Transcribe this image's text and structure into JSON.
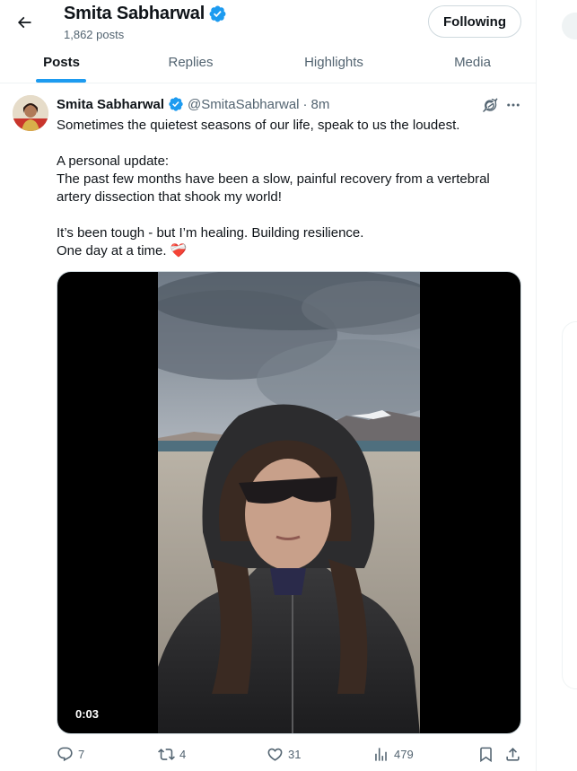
{
  "header": {
    "name": "Smita Sabharwal",
    "post_count": "1,862 posts",
    "follow_label": "Following"
  },
  "tabs": [
    {
      "label": "Posts",
      "active": true
    },
    {
      "label": "Replies",
      "active": false
    },
    {
      "label": "Highlights",
      "active": false
    },
    {
      "label": "Media",
      "active": false
    }
  ],
  "tweet": {
    "name": "Smita Sabharwal",
    "handle": "@SmitaSabharwal",
    "separator": "·",
    "time": "8m",
    "lines": [
      "Sometimes the quietest seasons of our life, speak to us the loudest.",
      "",
      "A personal update:",
      "The past few months have been a slow, painful recovery from a vertebral artery dissection that shook my world!",
      "",
      "It’s been tough - but I’m healing. Building resilience.",
      "One day at a time. ❤️‍🩹"
    ],
    "video_timestamp": "0:03",
    "stats": {
      "replies": "7",
      "reposts": "4",
      "likes": "31",
      "views": "479"
    }
  },
  "colors": {
    "accent": "#1d9bf0",
    "verified": "#1d9bf0",
    "secondary_text": "#536471",
    "border": "#eff3f4"
  },
  "icons": [
    "back-arrow-icon",
    "verified-badge-icon",
    "grok-icon",
    "more-icon",
    "reply-icon",
    "repost-icon",
    "like-icon",
    "views-icon",
    "bookmark-icon",
    "share-icon"
  ]
}
